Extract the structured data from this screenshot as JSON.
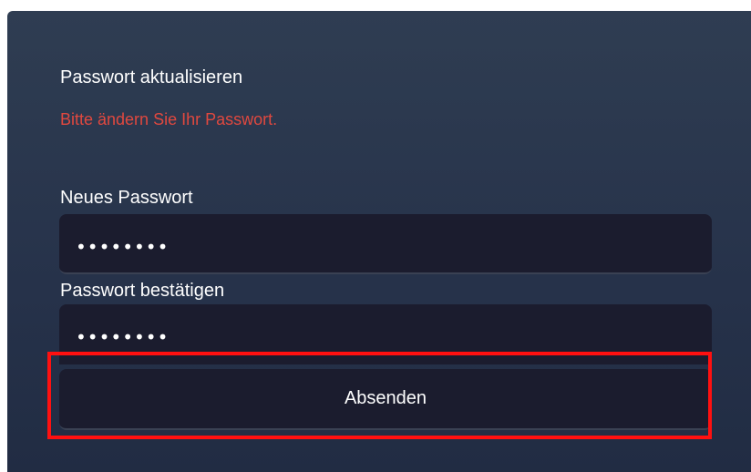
{
  "form": {
    "title": "Passwort aktualisieren",
    "warning": "Bitte ändern Sie Ihr Passwort.",
    "new_password": {
      "label": "Neues Passwort",
      "value": "••••••••"
    },
    "confirm_password": {
      "label": "Passwort bestätigen",
      "value": "••••••••"
    },
    "submit_label": "Absenden"
  },
  "colors": {
    "panel_background": "#2a374d",
    "field_background": "#1b1c2e",
    "warning_text": "#e0483f",
    "highlight_border": "#ff1010"
  }
}
